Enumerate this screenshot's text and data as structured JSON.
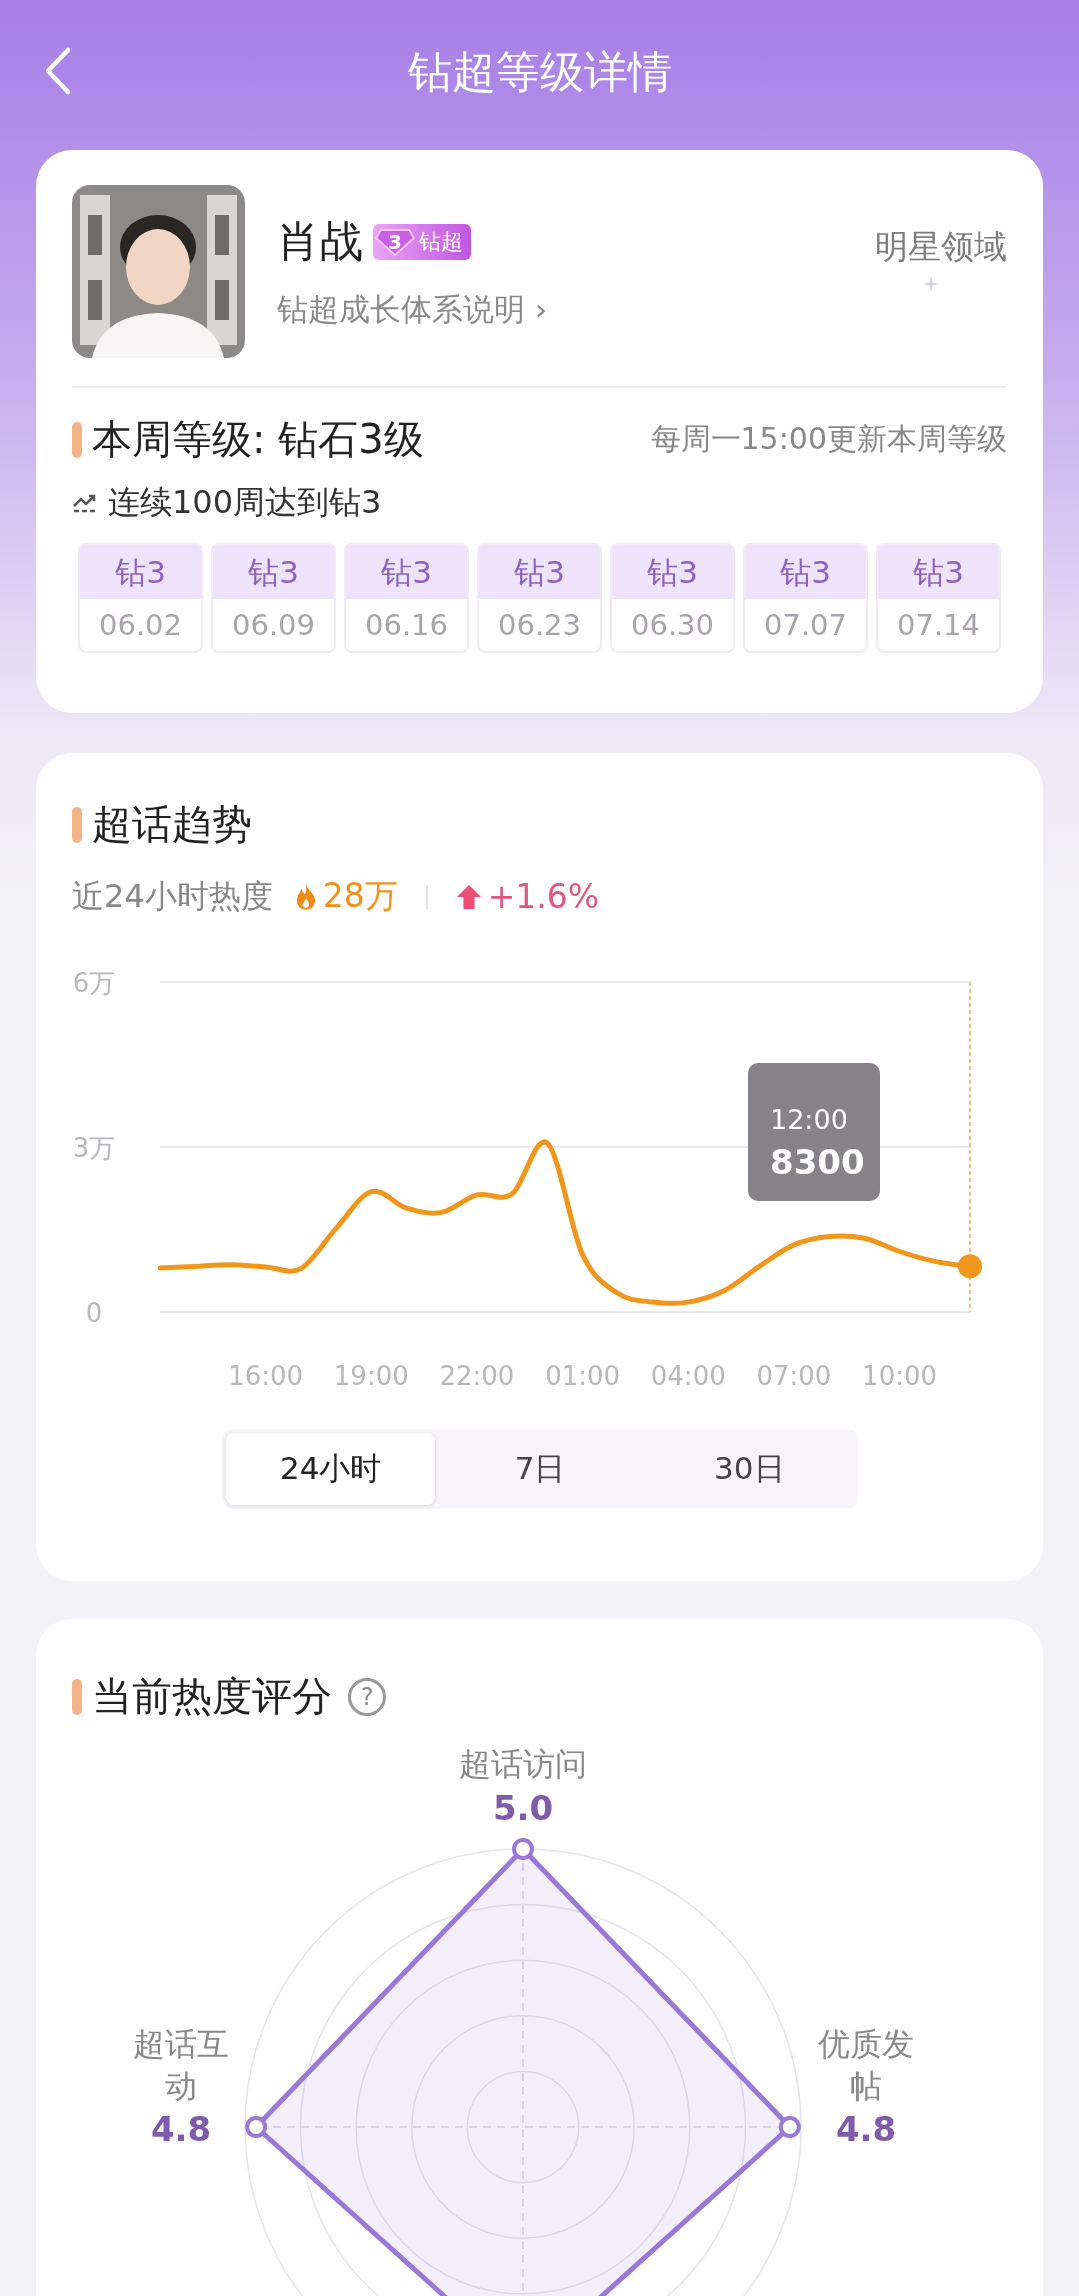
{
  "header": {
    "title": "钻超等级详情"
  },
  "profile": {
    "name": "肖战",
    "badge": {
      "rank": "3",
      "label": "钻超"
    },
    "link": "钻超成长体系说明",
    "link_arrow": "›",
    "domain": "明星领域"
  },
  "level": {
    "title": "本周等级: 钻石3级",
    "note": "每周一15:00更新本周等级",
    "streak": "连续100周达到钻3",
    "weeks": [
      {
        "grade": "钻3",
        "date": "06.02"
      },
      {
        "grade": "钻3",
        "date": "06.09"
      },
      {
        "grade": "钻3",
        "date": "06.16"
      },
      {
        "grade": "钻3",
        "date": "06.23"
      },
      {
        "grade": "钻3",
        "date": "06.30"
      },
      {
        "grade": "钻3",
        "date": "07.07"
      },
      {
        "grade": "钻3",
        "date": "07.14"
      }
    ]
  },
  "trend": {
    "title": "超话趋势",
    "heat_label": "近24小时热度",
    "heat_value": "28万",
    "change": "+1.6%",
    "chart_data": {
      "type": "line",
      "x": [
        null,
        null,
        null,
        "16:00",
        null,
        null,
        "19:00",
        null,
        null,
        "22:00",
        null,
        null,
        "01:00",
        null,
        null,
        "04:00",
        null,
        null,
        "07:00",
        null,
        null,
        "10:00",
        null,
        null
      ],
      "series": [
        {
          "color": "#f0961a",
          "values": [
            0.8,
            0.83,
            0.86,
            0.82,
            0.79,
            1.52,
            2.19,
            1.89,
            1.81,
            2.13,
            2.15,
            3.07,
            1.04,
            0.34,
            0.18,
            0.18,
            0.38,
            0.82,
            1.22,
            1.37,
            1.34,
            1.1,
            0.92,
            0.83
          ]
        }
      ],
      "ylim": [
        0,
        6
      ],
      "yticks": [
        {
          "value": 0,
          "label": "0"
        },
        {
          "value": 3,
          "label": "3万"
        },
        {
          "value": 6,
          "label": "6万"
        }
      ]
    },
    "tooltip": {
      "time": "12:00",
      "value": "8300"
    },
    "ranges": [
      {
        "label": "24小时",
        "selected": true
      },
      {
        "label": "7日",
        "selected": false
      },
      {
        "label": "30日",
        "selected": false
      }
    ]
  },
  "score": {
    "title": "当前热度评分",
    "help_icon": "?",
    "axes": [
      {
        "kind": "top",
        "label": "超话访问",
        "value": "5.0"
      },
      {
        "kind": "left",
        "label": "超话互动",
        "value": "4.8"
      },
      {
        "kind": "right",
        "label": "优质发帖",
        "value": "4.8"
      }
    ]
  }
}
